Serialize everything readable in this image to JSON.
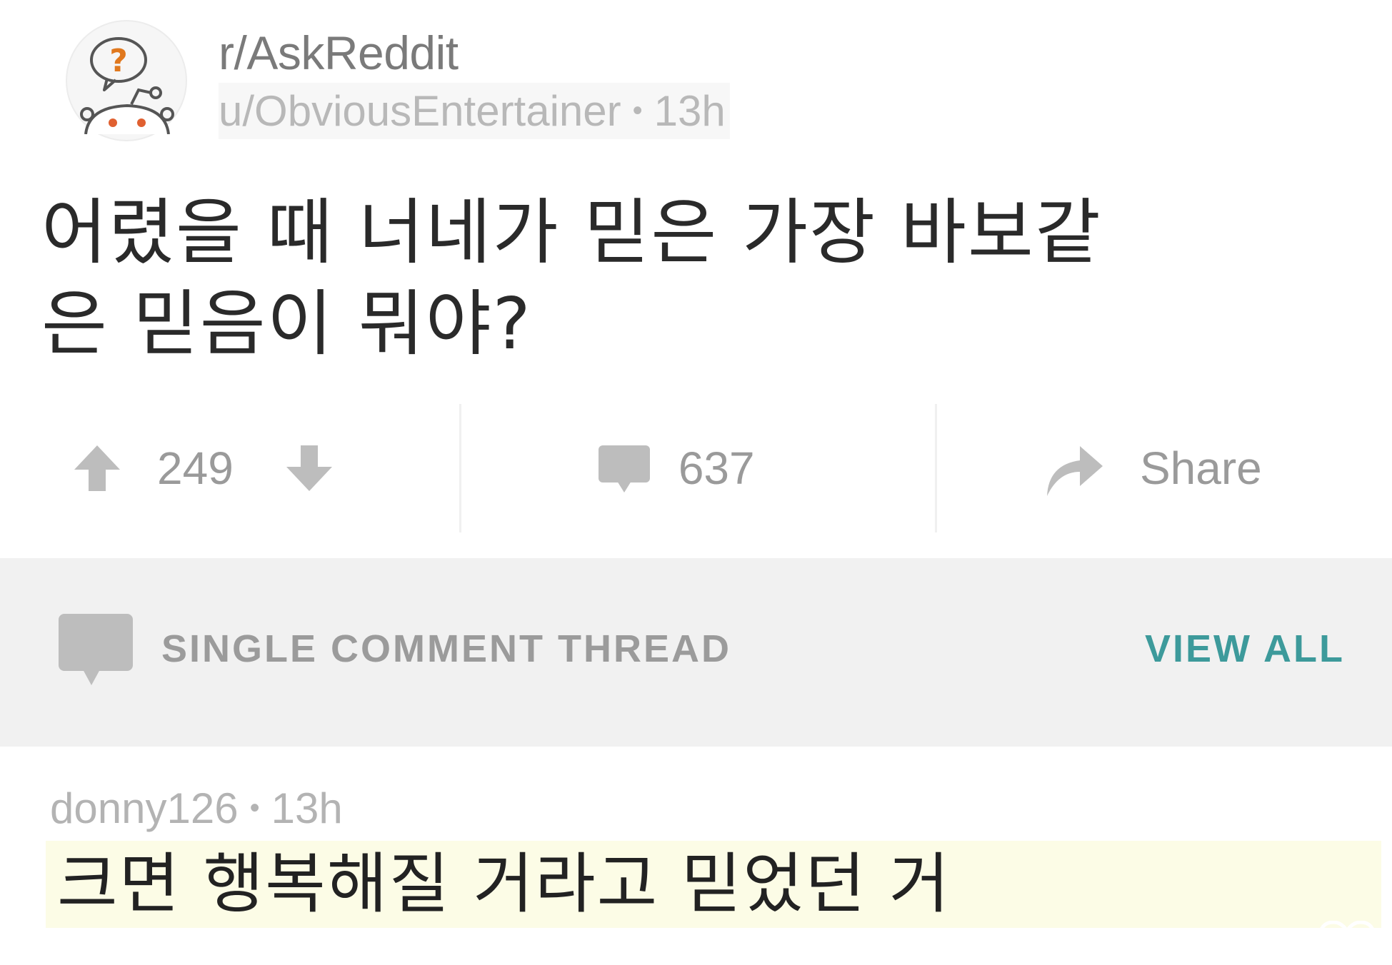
{
  "post": {
    "subreddit": "r/AskReddit",
    "author": "u/ObviousEntertainer",
    "separator": "•",
    "age": "13h",
    "title": "어렸을 때 너네가 믿은 가장 바보같은 믿음이 뭐야?"
  },
  "actions": {
    "score": "249",
    "comments": "637",
    "share_label": "Share"
  },
  "thread": {
    "label": "SINGLE COMMENT THREAD",
    "view_all": "VIEW ALL"
  },
  "comment": {
    "author": "donny126",
    "separator": "•",
    "age": "13h",
    "body": "크면 행복해질 거라고 믿었던 거"
  },
  "icons": {
    "avatar": "askreddit-snoo-icon",
    "upvote": "upvote-arrow-icon",
    "downvote": "downvote-arrow-icon",
    "comments": "comment-bubble-icon",
    "share": "share-arrow-icon",
    "thread": "comment-bubble-icon",
    "heart": "heart-outline-icon"
  },
  "colors": {
    "view_all": "#3d9a9b",
    "icon_grey": "#bdbdbd",
    "band": "#f1f1f1",
    "highlight": "#fcfce6"
  }
}
